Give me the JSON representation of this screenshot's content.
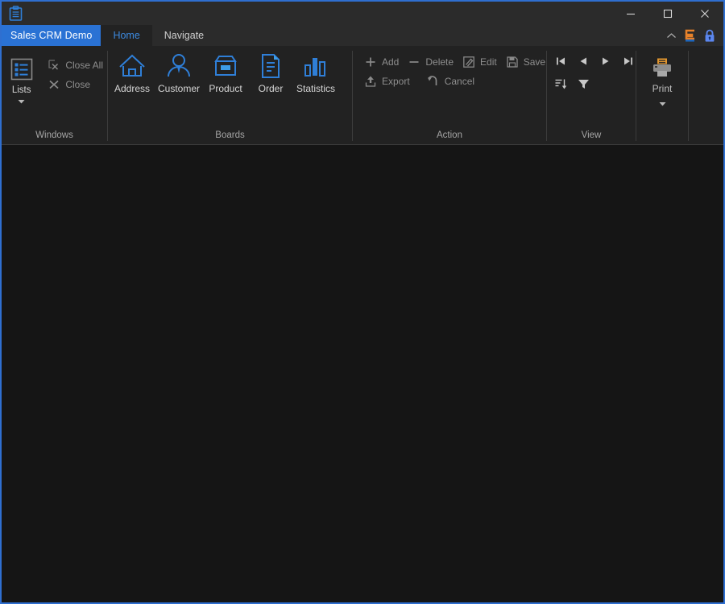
{
  "window": {
    "app_icon": "clipboard-icon",
    "border_color": "#2f6fd0",
    "controls": {
      "minimize": "minimize-icon",
      "maximize": "maximize-icon",
      "close": "close-icon"
    }
  },
  "tabbar": {
    "app_tab_label": "Sales CRM Demo",
    "tabs": [
      {
        "label": "Home",
        "active": true
      },
      {
        "label": "Navigate",
        "active": false
      }
    ],
    "right_icons": [
      {
        "name": "chevron-up-icon",
        "color": "#b0b0b0"
      },
      {
        "name": "brand-logo-icon",
        "color": "#e8822a"
      },
      {
        "name": "lock-icon",
        "color": "#5b87f0"
      }
    ]
  },
  "ribbon": {
    "groups": [
      {
        "label": "Windows",
        "big_buttons": [
          {
            "label": "Lists",
            "icon": "list-icon",
            "enabled": true,
            "has_caret": true
          }
        ],
        "small_buttons": [
          {
            "label": "Close All",
            "icon": "close-all-icon",
            "enabled": false
          },
          {
            "label": "Close",
            "icon": "close-x-icon",
            "enabled": false
          }
        ]
      },
      {
        "label": "Boards",
        "board_buttons": [
          {
            "label": "Address",
            "icon": "home-icon"
          },
          {
            "label": "Customer",
            "icon": "person-icon"
          },
          {
            "label": "Product",
            "icon": "box-icon"
          },
          {
            "label": "Order",
            "icon": "document-icon"
          },
          {
            "label": "Statistics",
            "icon": "bar-chart-icon"
          }
        ]
      },
      {
        "label": "Action",
        "small_buttons_row1": [
          {
            "label": "Add",
            "icon": "plus-icon",
            "enabled": false
          },
          {
            "label": "Delete",
            "icon": "minus-icon",
            "enabled": false
          },
          {
            "label": "Edit",
            "icon": "pencil-square-icon",
            "enabled": false
          },
          {
            "label": "Save",
            "icon": "floppy-disk-icon",
            "enabled": false
          }
        ],
        "small_buttons_row2": [
          {
            "label": "Export",
            "icon": "export-upload-icon",
            "enabled": false
          },
          {
            "label": "Cancel",
            "icon": "undo-arrow-icon",
            "enabled": false
          }
        ]
      },
      {
        "label": "View",
        "nav_icons": [
          {
            "name": "first-record-icon"
          },
          {
            "name": "previous-record-icon"
          },
          {
            "name": "next-record-icon"
          },
          {
            "name": "last-record-icon"
          }
        ],
        "tool_icons": [
          {
            "name": "sort-icon"
          },
          {
            "name": "filter-icon"
          }
        ]
      },
      {
        "label": "",
        "print_button": {
          "label": "Print",
          "icon": "printer-icon",
          "has_caret": true
        }
      }
    ]
  },
  "content": {
    "background": "#151515",
    "text": ""
  }
}
